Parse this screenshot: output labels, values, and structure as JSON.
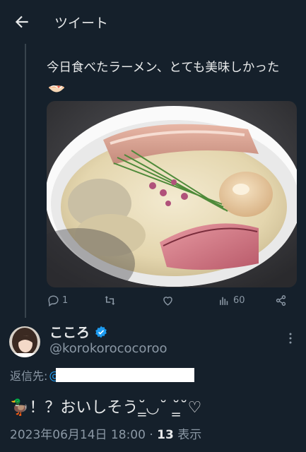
{
  "header": {
    "title": "ツイート",
    "back_icon": "arrow-left-icon"
  },
  "quoted": {
    "text": "今日食べたラーメン、とても美味しかった",
    "emoji": "ramen-bowl-icon",
    "stats": {
      "replies": "1",
      "views": "60"
    },
    "action_icons": [
      "reply-icon",
      "retweet-icon",
      "like-icon",
      "views-icon",
      "share-icon"
    ]
  },
  "tweet": {
    "name": "こころ",
    "handle": "@korokorococoroo",
    "verified_icon": "verified-badge-icon",
    "reply_label": "返信先:",
    "reply_to_prefix": "@",
    "text": "🦆！？おいしそう˘̳◡˘ ˘̳˘♡",
    "date": "2023年06月14日 18:00",
    "separator": " · ",
    "view_count": "13",
    "view_label": " 表示"
  },
  "colors": {
    "background": "#15202b",
    "accent": "#1d9bf0",
    "text": "#e7e9ea",
    "muted": "#8b98a5"
  }
}
